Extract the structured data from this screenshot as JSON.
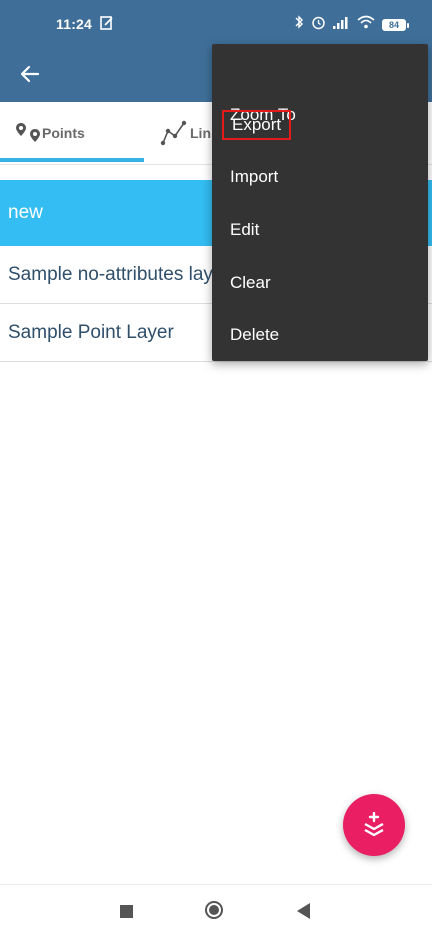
{
  "status_bar": {
    "time": "11:24",
    "battery": "84"
  },
  "tabs": [
    {
      "label": "Points",
      "icon": "map-pins-icon"
    },
    {
      "label": "Lin",
      "icon": "polyline-icon"
    }
  ],
  "layers": [
    {
      "name": "new"
    },
    {
      "name": "Sample no-attributes layer"
    },
    {
      "name": "Sample Point Layer"
    }
  ],
  "menu": {
    "items": [
      "Zoom To",
      "Export",
      "Import",
      "Edit",
      "Clear",
      "Delete"
    ]
  },
  "colors": {
    "app_bar": "#3f6f99",
    "selected_row": "#33bdf2",
    "fab": "#e91e63",
    "menu_bg": "#333333",
    "highlight_border": "#e31b1b"
  }
}
